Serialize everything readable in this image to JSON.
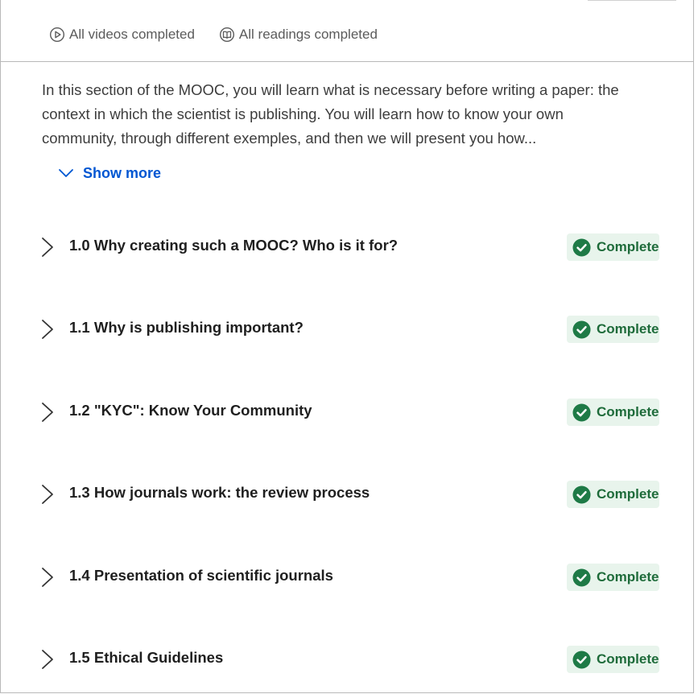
{
  "status": {
    "videos": {
      "icon": "play-circle-icon",
      "label": "All videos completed"
    },
    "readings": {
      "icon": "book-icon",
      "label": "All readings completed"
    }
  },
  "description": "In this section of the MOOC, you will learn what is necessary before writing a paper: the context in which the scientist is publishing. You will learn how to know your own community, through different exemples, and then we will present you how...",
  "show_more": {
    "icon": "chevron-down-icon",
    "label": "Show more"
  },
  "lessons": [
    {
      "title": "1.0 Why creating such a MOOC? Who is it for?",
      "status": "Complete"
    },
    {
      "title": "1.1 Why is publishing important?",
      "status": "Complete"
    },
    {
      "title": "1.2 \"KYC\": Know Your Community",
      "status": "Complete"
    },
    {
      "title": "1.3 How journals work: the review process",
      "status": "Complete"
    },
    {
      "title": "1.4 Presentation of scientific journals",
      "status": "Complete"
    },
    {
      "title": "1.5 Ethical Guidelines",
      "status": "Complete"
    }
  ],
  "colors": {
    "accent": "#0056d2",
    "complete_green": "#1e7a46",
    "complete_bg": "#e8f4ec"
  }
}
